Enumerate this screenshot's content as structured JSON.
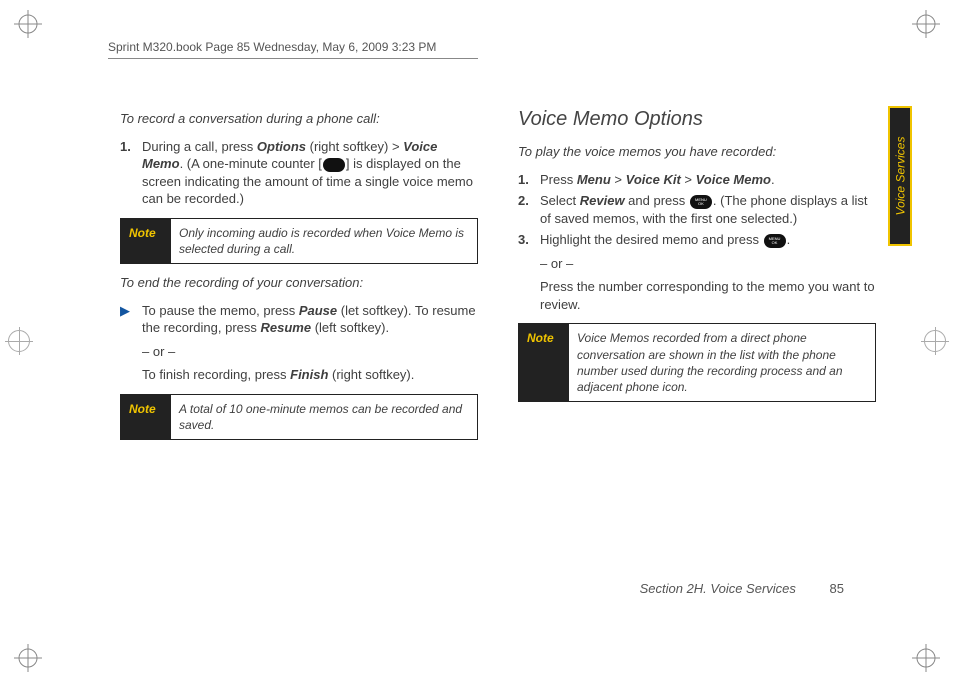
{
  "running_head": "Sprint M320.book  Page 85  Wednesday, May 6, 2009  3:23 PM",
  "side_tab": "Voice Services",
  "footer": {
    "section": "Section 2H. Voice Services",
    "page": "85"
  },
  "left": {
    "intro1": "To record a conversation during a phone call:",
    "step1_pre": "During a call, press ",
    "step1_opt": "Options",
    "step1_mid": " (right softkey) > ",
    "step1_vm": "Voice Memo",
    "step1_post1": ". (A one-minute counter [",
    "step1_post2": "] is displayed on the screen indicating the amount of time a single voice memo can be recorded.)",
    "note1_label": "Note",
    "note1_text": "Only incoming audio is recorded when Voice Memo is selected during a call.",
    "intro2": "To end the recording of your conversation:",
    "bullet_pre": "To pause the memo, press ",
    "bullet_pause": "Pause",
    "bullet_mid1": " (let softkey). To resume the recording, press ",
    "bullet_resume": "Resume",
    "bullet_post1": " (left softkey).",
    "or": "– or –",
    "bullet2_pre": "To finish recording, press ",
    "bullet2_finish": "Finish",
    "bullet2_post": " (right softkey).",
    "note2_label": "Note",
    "note2_text": "A total of 10 one-minute memos can be recorded and saved."
  },
  "right": {
    "heading": "Voice Memo Options",
    "intro": "To play the voice memos you have recorded:",
    "s1_pre": "Press ",
    "s1_menu": "Menu",
    "s1_gt1": " > ",
    "s1_vk": "Voice Kit",
    "s1_gt2": " > ",
    "s1_vm": "Voice Memo",
    "s1_post": ".",
    "s2_pre": "Select ",
    "s2_review": "Review",
    "s2_mid": " and press ",
    "s2_post": ". (The phone displays a list of saved memos, with the first one selected.)",
    "s3_pre": "Highlight the desired memo and press ",
    "s3_post": ".",
    "or": "– or –",
    "s3_alt": "Press the number corresponding to the memo you want to review.",
    "note_label": "Note",
    "note_text": "Voice Memos recorded from a direct phone conversation are shown in the list with the phone number used during the recording process and an adjacent phone icon."
  }
}
